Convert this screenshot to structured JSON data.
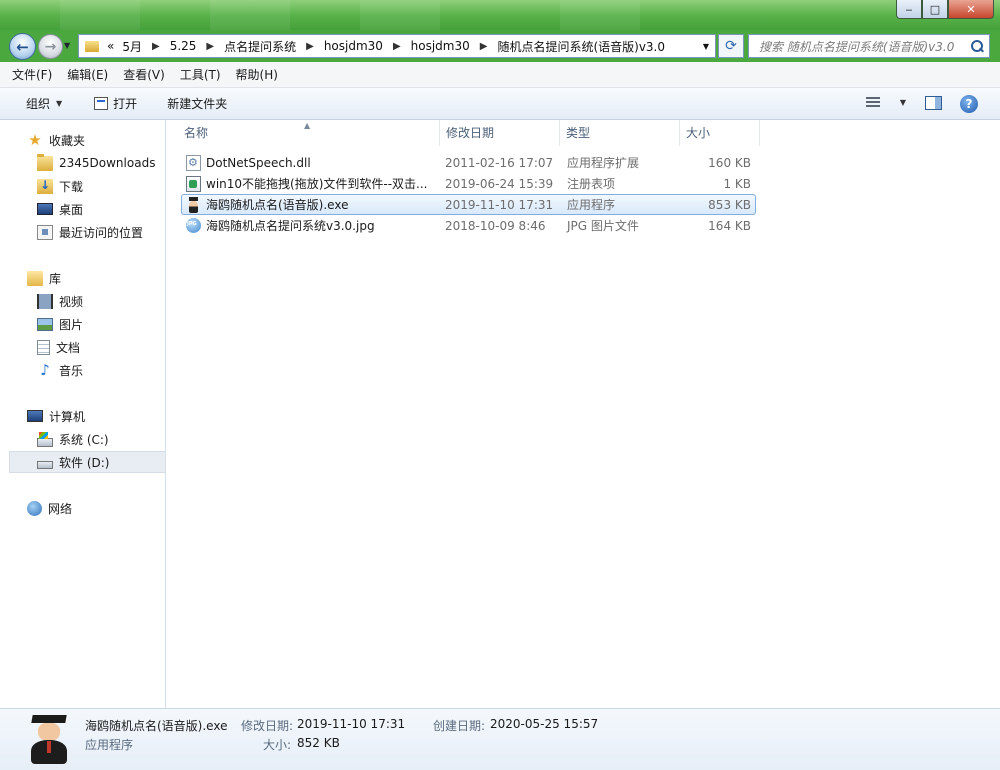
{
  "window": {
    "controls": {
      "minimize": "‒",
      "maximize": "□",
      "close": "✕"
    }
  },
  "address": {
    "overflow": "«",
    "segments": [
      "5月",
      "5.25",
      "点名提问系统",
      "hosjdm30",
      "hosjdm30",
      "随机点名提问系统(语音版)v3.0"
    ]
  },
  "search": {
    "placeholder": "搜索 随机点名提问系统(语音版)v3.0"
  },
  "menu": [
    "文件(F)",
    "编辑(E)",
    "查看(V)",
    "工具(T)",
    "帮助(H)"
  ],
  "toolbar": {
    "organize": "组织",
    "open": "打开",
    "new_folder": "新建文件夹",
    "help": "?"
  },
  "nav": {
    "favorites": "收藏夹",
    "favorites_items": [
      "2345Downloads",
      "下载",
      "桌面",
      "最近访问的位置"
    ],
    "libraries": "库",
    "library_items": [
      "视频",
      "图片",
      "文档",
      "音乐"
    ],
    "computer": "计算机",
    "drives": [
      "系统 (C:)",
      "软件 (D:)"
    ],
    "network": "网络"
  },
  "columns": {
    "name": "名称",
    "date": "修改日期",
    "type": "类型",
    "size": "大小"
  },
  "files": [
    {
      "name": "DotNetSpeech.dll",
      "date": "2011-02-16 17:07",
      "type": "应用程序扩展",
      "size": "160 KB",
      "icon": "dll-icon"
    },
    {
      "name": "win10不能拖拽(拖放)文件到软件--双击...",
      "date": "2019-06-24 15:39",
      "type": "注册表项",
      "size": "1 KB",
      "icon": "registry-icon"
    },
    {
      "name": "海鸥随机点名(语音版).exe",
      "date": "2019-11-10 17:31",
      "type": "应用程序",
      "size": "853 KB",
      "icon": "exe-icon",
      "selected": true
    },
    {
      "name": "海鸥随机点名提问系统v3.0.jpg",
      "date": "2018-10-09 8:46",
      "type": "JPG 图片文件",
      "size": "164 KB",
      "icon": "jpg-icon"
    }
  ],
  "details": {
    "filename": "海鸥随机点名(语音版).exe",
    "filetype": "应用程序",
    "modified_label": "修改日期:",
    "modified": "2019-11-10 17:31",
    "created_label": "创建日期:",
    "created": "2020-05-25 15:57",
    "size_label": "大小:",
    "size": "852 KB"
  },
  "colors": {
    "titlebar": "#59b24a",
    "selection": "#d8e9fb",
    "selection_border": "#84acdd"
  }
}
